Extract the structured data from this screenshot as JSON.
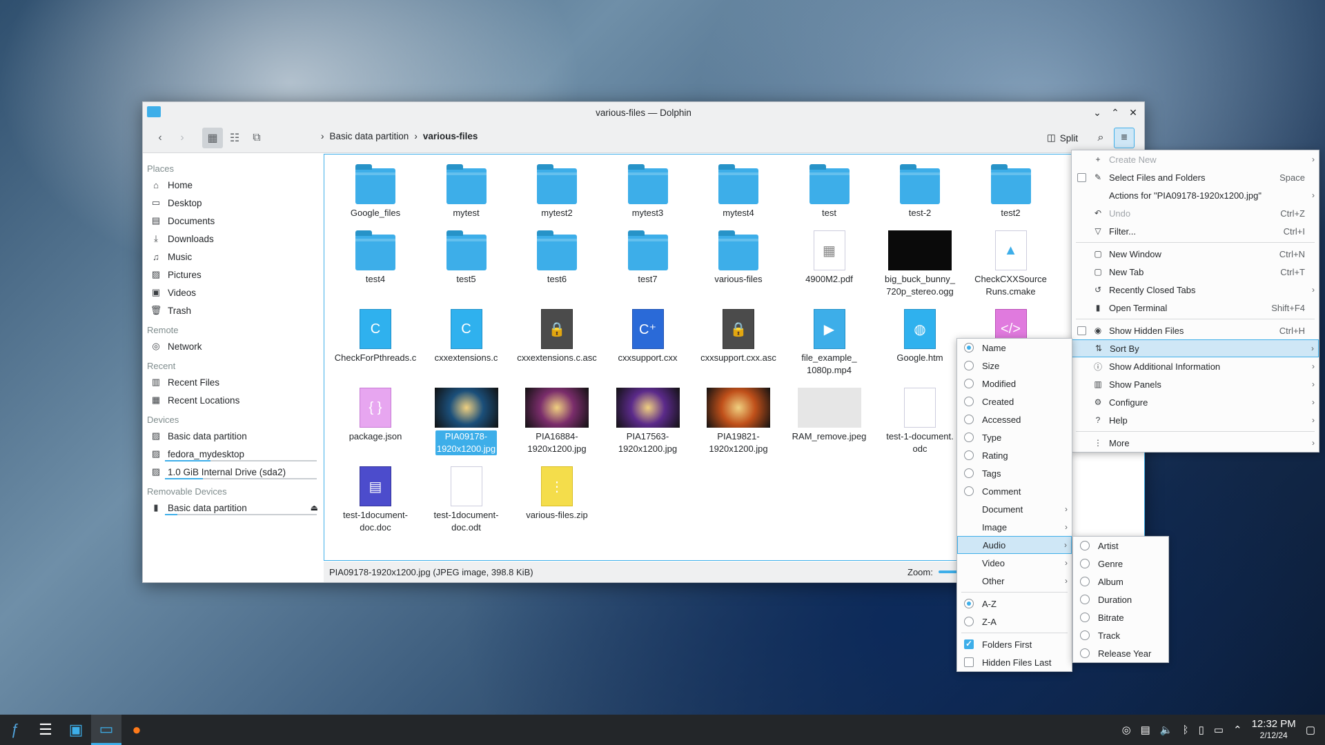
{
  "window": {
    "title": "various-files — Dolphin"
  },
  "toolbar": {
    "breadcrumb": [
      "Basic data partition",
      "various-files"
    ],
    "split_label": "Split"
  },
  "sidebar": {
    "sections": [
      {
        "title": "Places",
        "items": [
          {
            "label": "Home",
            "icon": "home-icon"
          },
          {
            "label": "Desktop",
            "icon": "desktop-icon"
          },
          {
            "label": "Documents",
            "icon": "documents-icon"
          },
          {
            "label": "Downloads",
            "icon": "downloads-icon"
          },
          {
            "label": "Music",
            "icon": "music-icon"
          },
          {
            "label": "Pictures",
            "icon": "pictures-icon"
          },
          {
            "label": "Videos",
            "icon": "videos-icon"
          },
          {
            "label": "Trash",
            "icon": "trash-icon"
          }
        ]
      },
      {
        "title": "Remote",
        "items": [
          {
            "label": "Network",
            "icon": "network-icon"
          }
        ]
      },
      {
        "title": "Recent",
        "items": [
          {
            "label": "Recent Files",
            "icon": "recent-files-icon"
          },
          {
            "label": "Recent Locations",
            "icon": "recent-locations-icon"
          }
        ]
      },
      {
        "title": "Devices",
        "items": [
          {
            "label": "Basic data partition",
            "icon": "drive-icon"
          },
          {
            "label": "fedora_mydesktop",
            "icon": "drive-icon",
            "usage": 0.3
          },
          {
            "label": "1.0 GiB Internal Drive (sda2)",
            "icon": "drive-icon",
            "usage": 0.25
          }
        ]
      },
      {
        "title": "Removable Devices",
        "items": [
          {
            "label": "Basic data partition",
            "icon": "usb-drive-icon",
            "usage": 0.08
          }
        ]
      }
    ]
  },
  "files": [
    {
      "name": "Google_files",
      "kind": "folder"
    },
    {
      "name": "mytest",
      "kind": "folder"
    },
    {
      "name": "mytest2",
      "kind": "folder"
    },
    {
      "name": "mytest3",
      "kind": "folder"
    },
    {
      "name": "mytest4",
      "kind": "folder"
    },
    {
      "name": "test",
      "kind": "folder"
    },
    {
      "name": "test-2",
      "kind": "folder"
    },
    {
      "name": "test2",
      "kind": "folder"
    },
    {
      "name": "test4",
      "kind": "folder"
    },
    {
      "name": "test5",
      "kind": "folder"
    },
    {
      "name": "test6",
      "kind": "folder"
    },
    {
      "name": "test7",
      "kind": "folder"
    },
    {
      "name": "various-files",
      "kind": "folder"
    },
    {
      "name": "4900M2.pdf",
      "kind": "pdf"
    },
    {
      "name": "big_buck_bunny_\n720p_stereo.ogg",
      "kind": "video-dark"
    },
    {
      "name": "CheckCXXSource\nRuns.cmake",
      "kind": "cmake"
    },
    {
      "name": "CheckForPthreads.c",
      "kind": "c"
    },
    {
      "name": "cxxextensions.c",
      "kind": "c"
    },
    {
      "name": "cxxextensions.c.asc",
      "kind": "lock"
    },
    {
      "name": "cxxsupport.cxx",
      "kind": "cxx"
    },
    {
      "name": "cxxsupport.cxx.asc",
      "kind": "lock"
    },
    {
      "name": "file_example_\n1080p.mp4",
      "kind": "vid"
    },
    {
      "name": "Google.htm",
      "kind": "htm"
    },
    {
      "name": "",
      "kind": "xml"
    },
    {
      "name": "package.json",
      "kind": "json"
    },
    {
      "name": "PIA09178-\n1920x1200.jpg",
      "kind": "img",
      "color": "#1b4f7a",
      "selected": true
    },
    {
      "name": "PIA16884-\n1920x1200.jpg",
      "kind": "img",
      "color": "#7a2d6b"
    },
    {
      "name": "PIA17563-\n1920x1200.jpg",
      "kind": "img",
      "color": "#5b2a8a"
    },
    {
      "name": "PIA19821-\n1920x1200.jpg",
      "kind": "img",
      "color": "#c0501a"
    },
    {
      "name": "RAM_remove.jpeg",
      "kind": "img",
      "color": "#d9d9d9"
    },
    {
      "name": "test-1-document.\nodc",
      "kind": "odt"
    },
    {
      "name": "test-1document-\ndoc.doc",
      "kind": "blue"
    },
    {
      "name": "test-1document-\ndoc.odt",
      "kind": "odt"
    },
    {
      "name": "various-files.zip",
      "kind": "zip"
    }
  ],
  "status": {
    "text": "PIA09178-1920x1200.jpg (JPEG image, 398.8 KiB)",
    "zoom_label": "Zoom:"
  },
  "main_menu": {
    "items": [
      {
        "label": "Create New",
        "icon": "plus-icon",
        "disabled": true,
        "submenu": true
      },
      {
        "label": "Select Files and Folders",
        "icon": "select-icon",
        "shortcut": "Space",
        "checkbox": true
      },
      {
        "label": "Actions for \"PIA09178-1920x1200.jpg\"",
        "submenu": true
      },
      {
        "label": "Undo",
        "icon": "undo-icon",
        "shortcut": "Ctrl+Z",
        "disabled": true
      },
      {
        "label": "Filter...",
        "icon": "filter-icon",
        "shortcut": "Ctrl+I"
      },
      {
        "sep": true
      },
      {
        "label": "New Window",
        "icon": "window-icon",
        "shortcut": "Ctrl+N"
      },
      {
        "label": "New Tab",
        "icon": "tab-icon",
        "shortcut": "Ctrl+T"
      },
      {
        "label": "Recently Closed Tabs",
        "icon": "history-icon",
        "submenu": true
      },
      {
        "label": "Open Terminal",
        "icon": "terminal-icon",
        "shortcut": "Shift+F4"
      },
      {
        "sep": true
      },
      {
        "label": "Show Hidden Files",
        "icon": "eye-icon",
        "shortcut": "Ctrl+H",
        "checkbox": true
      },
      {
        "label": "Sort By",
        "icon": "sort-icon",
        "submenu": true,
        "highlight": true
      },
      {
        "label": "Show Additional Information",
        "icon": "info-icon",
        "submenu": true
      },
      {
        "label": "Show Panels",
        "icon": "panels-icon",
        "submenu": true
      },
      {
        "label": "Configure",
        "icon": "configure-icon",
        "submenu": true
      },
      {
        "label": "Help",
        "icon": "help-icon",
        "submenu": true
      },
      {
        "sep": true
      },
      {
        "label": "More",
        "icon": "more-icon",
        "submenu": true
      }
    ]
  },
  "sort_menu": {
    "items": [
      {
        "label": "Name",
        "radio": true,
        "on": true
      },
      {
        "label": "Size",
        "radio": true
      },
      {
        "label": "Modified",
        "radio": true
      },
      {
        "label": "Created",
        "radio": true
      },
      {
        "label": "Accessed",
        "radio": true
      },
      {
        "label": "Type",
        "radio": true
      },
      {
        "label": "Rating",
        "radio": true
      },
      {
        "label": "Tags",
        "radio": true
      },
      {
        "label": "Comment",
        "radio": true
      },
      {
        "label": "Document",
        "submenu": true
      },
      {
        "label": "Image",
        "submenu": true
      },
      {
        "label": "Audio",
        "submenu": true,
        "highlight": true
      },
      {
        "label": "Video",
        "submenu": true
      },
      {
        "label": "Other",
        "submenu": true
      },
      {
        "sep": true
      },
      {
        "label": "A-Z",
        "radio": true,
        "on": true
      },
      {
        "label": "Z-A",
        "radio": true
      },
      {
        "sep": true
      },
      {
        "label": "Folders First",
        "checkbox": true,
        "on": true
      },
      {
        "label": "Hidden Files Last",
        "checkbox": true
      }
    ]
  },
  "audio_menu": {
    "items": [
      {
        "label": "Artist"
      },
      {
        "label": "Genre"
      },
      {
        "label": "Album"
      },
      {
        "label": "Duration"
      },
      {
        "label": "Bitrate"
      },
      {
        "label": "Track"
      },
      {
        "label": "Release Year"
      }
    ]
  },
  "taskbar": {
    "apps": [
      "fedora-icon",
      "settings-icon",
      "store-icon",
      "dolphin-icon",
      "firefox-icon"
    ],
    "time": "12:32 PM",
    "date": "2/12/24"
  }
}
